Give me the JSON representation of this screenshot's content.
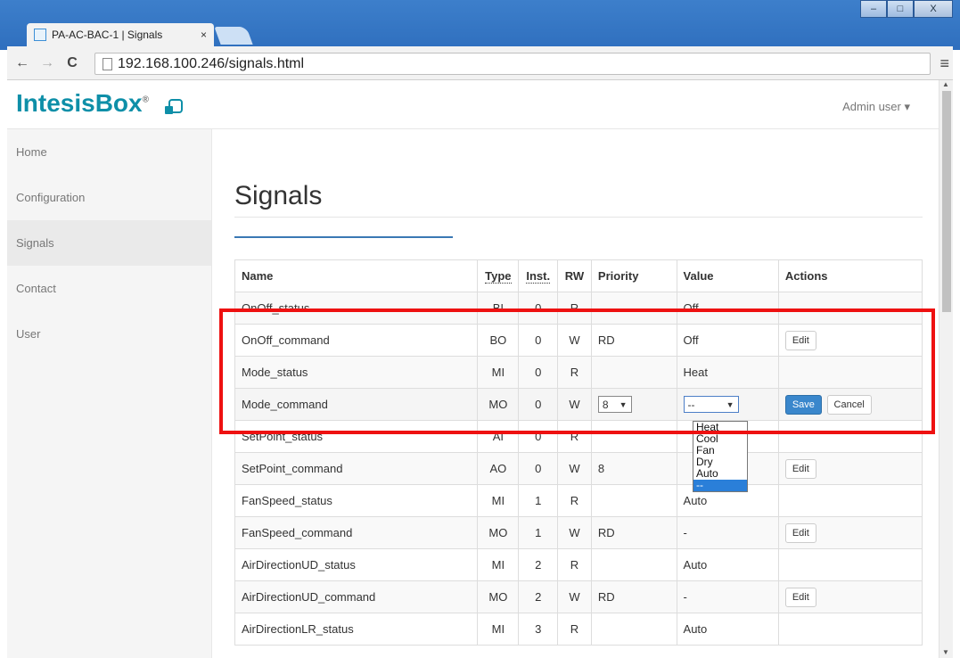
{
  "browser": {
    "tab_title": "PA-AC-BAC-1 | Signals",
    "tab_close": "×",
    "url": "192.168.100.246/signals.html",
    "back_icon": "←",
    "forward_icon": "→",
    "reload_icon": "C",
    "menu_icon": "≡",
    "win_min": "–",
    "win_max": "□",
    "win_close": "X"
  },
  "header": {
    "logo": "IntesisBox",
    "logo_reg": "®",
    "user_menu": "Admin user ▾"
  },
  "sidebar": {
    "items": [
      {
        "label": "Home"
      },
      {
        "label": "Configuration"
      },
      {
        "label": "Signals"
      },
      {
        "label": "Contact"
      },
      {
        "label": "User"
      }
    ]
  },
  "main": {
    "title": "Signals",
    "columns": [
      "Name",
      "Type",
      "Inst.",
      "RW",
      "Priority",
      "Value",
      "Actions"
    ],
    "rows": [
      {
        "name": "OnOff_status",
        "type": "BI",
        "inst": "0",
        "rw": "R",
        "priority": "",
        "value": "Off",
        "action": ""
      },
      {
        "name": "OnOff_command",
        "type": "BO",
        "inst": "0",
        "rw": "W",
        "priority": "RD",
        "value": "Off",
        "action": "Edit"
      },
      {
        "name": "Mode_status",
        "type": "MI",
        "inst": "0",
        "rw": "R",
        "priority": "",
        "value": "Heat",
        "action": ""
      },
      {
        "name": "Mode_command",
        "type": "MO",
        "inst": "0",
        "rw": "W",
        "priority": "8",
        "value": "--",
        "action": ""
      },
      {
        "name": "SetPoint_status",
        "type": "AI",
        "inst": "0",
        "rw": "R",
        "priority": "",
        "value": "",
        "action": ""
      },
      {
        "name": "SetPoint_command",
        "type": "AO",
        "inst": "0",
        "rw": "W",
        "priority": "8",
        "value": "",
        "action": "Edit"
      },
      {
        "name": "FanSpeed_status",
        "type": "MI",
        "inst": "1",
        "rw": "R",
        "priority": "",
        "value": "Auto",
        "action": ""
      },
      {
        "name": "FanSpeed_command",
        "type": "MO",
        "inst": "1",
        "rw": "W",
        "priority": "RD",
        "value": "-",
        "action": "Edit"
      },
      {
        "name": "AirDirectionUD_status",
        "type": "MI",
        "inst": "2",
        "rw": "R",
        "priority": "",
        "value": "Auto",
        "action": ""
      },
      {
        "name": "AirDirectionUD_command",
        "type": "MO",
        "inst": "2",
        "rw": "W",
        "priority": "RD",
        "value": "-",
        "action": "Edit"
      },
      {
        "name": "AirDirectionLR_status",
        "type": "MI",
        "inst": "3",
        "rw": "R",
        "priority": "",
        "value": "Auto",
        "action": ""
      }
    ],
    "edit_row": {
      "priority_select": "8",
      "priority_caret": "▼",
      "value_select": "--",
      "value_caret": "▼",
      "save_label": "Save",
      "cancel_label": "Cancel",
      "dropdown_options": [
        "Heat",
        "Cool",
        "Fan",
        "Dry",
        "Auto",
        "--"
      ]
    },
    "highlight_color": "#ee1111",
    "accent_color": "#3a87cc"
  }
}
